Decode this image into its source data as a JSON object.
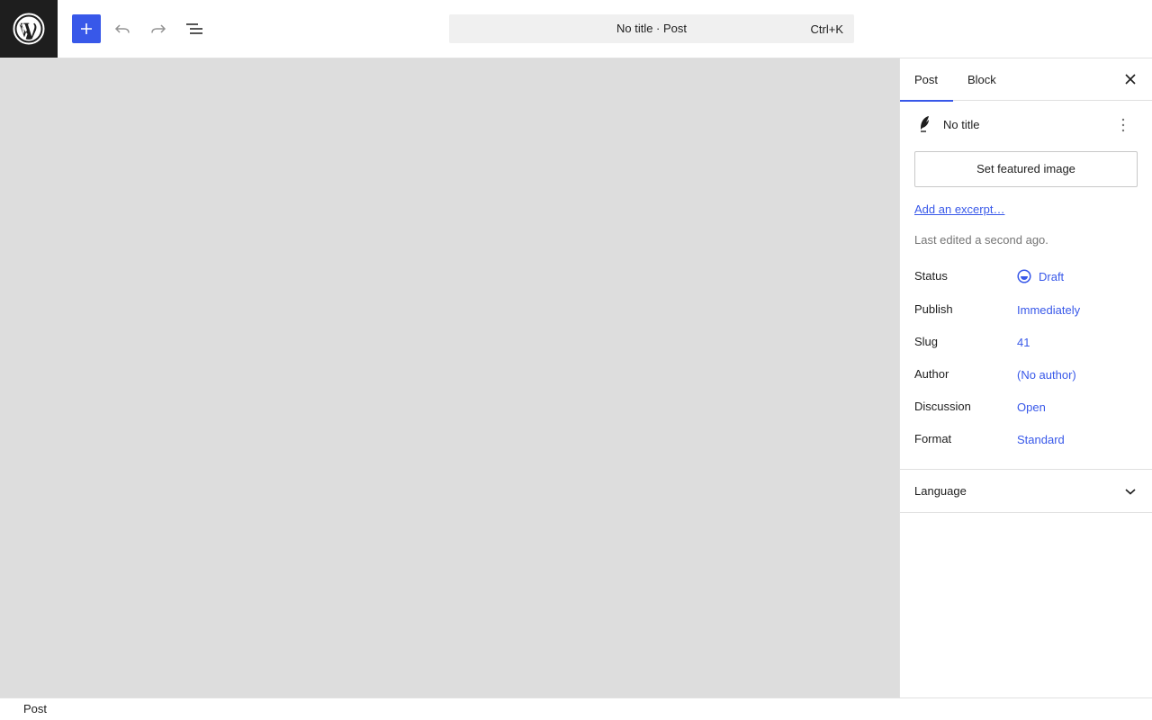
{
  "toolbar": {
    "logo_icon": "wordpress-logo-icon",
    "add_icon": "plus-icon",
    "undo_icon": "undo-icon",
    "redo_icon": "redo-icon",
    "list_view_icon": "list-view-icon",
    "accent_color": "#3858e9"
  },
  "command_bar": {
    "title": "No title · Post",
    "shortcut": "Ctrl+K"
  },
  "sidebar": {
    "tabs": [
      {
        "label": "Post",
        "active": true
      },
      {
        "label": "Block",
        "active": false
      }
    ],
    "close_icon": "close-icon",
    "post_title": "No title",
    "post_icon": "feather-icon",
    "more_icon": "more-vertical-icon",
    "featured_image_label": "Set featured image",
    "excerpt_link": "Add an excerpt…",
    "last_edited": "Last edited a second ago.",
    "meta": [
      {
        "label": "Status",
        "value": "Draft",
        "icon": "draft-status-icon"
      },
      {
        "label": "Publish",
        "value": "Immediately"
      },
      {
        "label": "Slug",
        "value": "41"
      },
      {
        "label": "Author",
        "value": "(No author)"
      },
      {
        "label": "Discussion",
        "value": "Open"
      },
      {
        "label": "Format",
        "value": "Standard"
      }
    ],
    "language_panel": {
      "label": "Language",
      "icon": "chevron-down-icon",
      "expanded": false
    }
  },
  "canvas": {
    "background": "#dddddd"
  },
  "footer": {
    "breadcrumb": "Post"
  }
}
